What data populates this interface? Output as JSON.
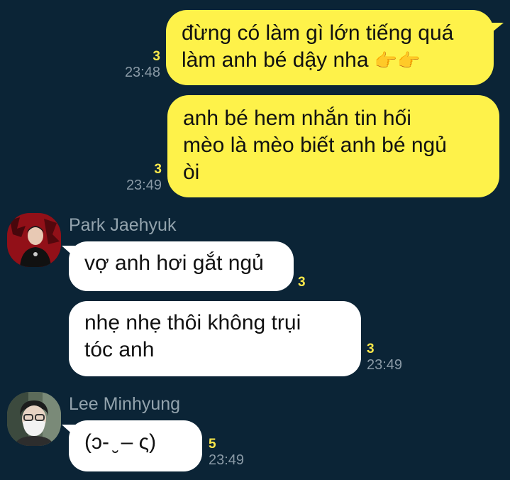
{
  "messages": [
    {
      "direction": "outgoing",
      "lines": [
        "đừng có làm gì lớn tiếng quá",
        "làm anh bé dậy nha"
      ],
      "emoji": "👉👉",
      "unread": "3",
      "time": "23:48"
    },
    {
      "direction": "outgoing",
      "lines": [
        "anh bé hem nhắn tin hối",
        "mèo là mèo biết anh bé ngủ",
        "òi"
      ],
      "unread": "3",
      "time": "23:49"
    },
    {
      "direction": "incoming",
      "sender": "Park Jaehyuk",
      "avatar_icon": "profile-photo-icon",
      "lines": [
        "vợ anh hơi gắt ngủ"
      ],
      "unread": "3"
    },
    {
      "direction": "incoming",
      "lines": [
        "nhẹ nhẹ thôi không trụi",
        "tóc anh"
      ],
      "unread": "3",
      "time": "23:49"
    },
    {
      "direction": "incoming",
      "sender": "Lee Minhyung",
      "avatar_icon": "profile-photo-icon",
      "lines": [
        "(ɔ- ̮ – ς)"
      ],
      "unread": "5",
      "time": "23:49"
    }
  ],
  "colors": {
    "background": "#0b2436",
    "outgoing_bubble": "#fef24a",
    "incoming_bubble": "#ffffff",
    "unread_count": "#fbe84a",
    "timestamp": "#8a9aa6",
    "sender_name": "#93a3ad"
  }
}
